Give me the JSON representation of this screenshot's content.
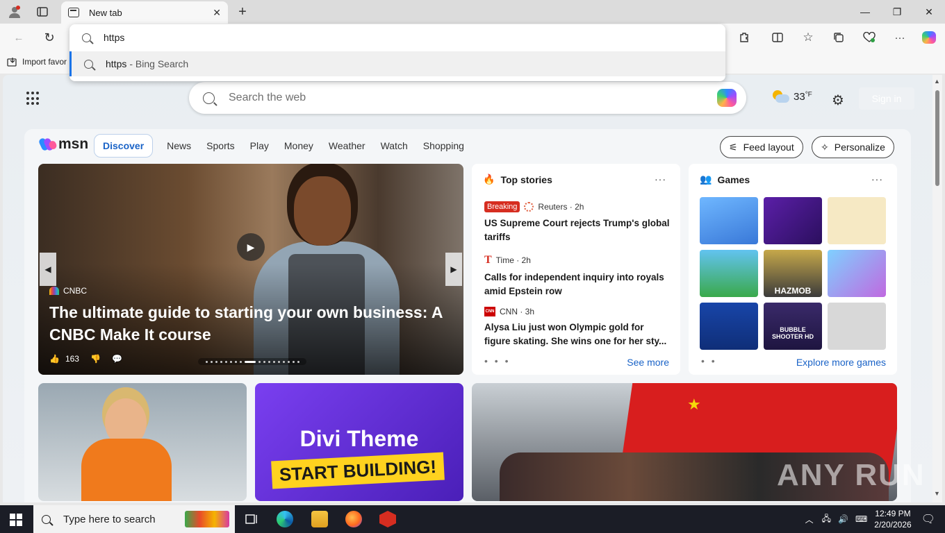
{
  "browser": {
    "tab_title": "New tab",
    "favorites_item": "Import favor",
    "omnibox_query": "https",
    "suggestion_text": "https",
    "suggestion_suffix": " - Bing Search"
  },
  "newtab": {
    "search_placeholder": "Search the web",
    "temperature": "33",
    "temp_unit": "°F",
    "signin": "Sign in"
  },
  "msn": {
    "brand": "msn",
    "nav": [
      "Discover",
      "News",
      "Sports",
      "Play",
      "Money",
      "Weather",
      "Watch",
      "Shopping"
    ],
    "feed_layout": "Feed layout",
    "personalize": "Personalize"
  },
  "hero": {
    "source": "CNBC",
    "title": "The ultimate guide to starting your own business: A CNBC Make It course",
    "likes": "163"
  },
  "top_stories": {
    "heading": "Top stories",
    "items": [
      {
        "badge": "Breaking",
        "source": "Reuters · 2h",
        "headline": "US Supreme Court rejects Trump's global tariffs"
      },
      {
        "source": "Time · 2h",
        "headline": "Calls for independent inquiry into royals amid Epstein row"
      },
      {
        "source": "CNN · 3h",
        "headline": "Alysa Liu just won Olympic gold for figure skating. She wins one for her sty..."
      }
    ],
    "see_more": "See more"
  },
  "games": {
    "heading": "Games",
    "tile_labels": [
      "HAZMOB",
      "BUBBLE SHOOTER HD"
    ],
    "explore": "Explore more games"
  },
  "tiles": {
    "divi_line1": "Divi Theme",
    "divi_line2": "START BUILDING!"
  },
  "taskbar": {
    "search_placeholder": "Type here to search",
    "time": "12:49 PM",
    "date": "2/20/2026"
  },
  "watermark": "ANY RUN",
  "colors": {
    "accent": "#1a63c7",
    "breaking": "#d62d20",
    "taskbar": "#1b1d26"
  }
}
